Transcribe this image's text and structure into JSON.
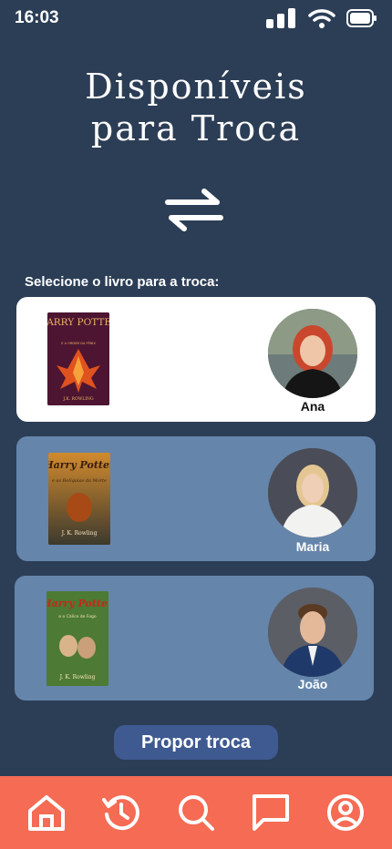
{
  "status": {
    "time": "16:03",
    "icons": [
      "signal-icon",
      "wifi-icon",
      "battery-icon"
    ]
  },
  "header": {
    "title_line1": "Disponíveis",
    "title_line2": "para Troca",
    "icon": "swap-arrows-icon"
  },
  "subtitle": "Selecione o livro para a troca:",
  "cards": [
    {
      "owner": "Ana",
      "book": {
        "title": "HARRY POTTER",
        "subtitle": "E A ORDEM DA FÊNIX",
        "author": "J.K. ROWLING"
      },
      "selected": true
    },
    {
      "owner": "Maria",
      "book": {
        "title": "Harry Potter",
        "subtitle": "e as Relíquias da Morte",
        "author": "J. K. Rowling"
      },
      "selected": false
    },
    {
      "owner": "João",
      "book": {
        "title": "Harry Potter",
        "subtitle": "e o Cálice de Fogo",
        "author": "J. K. Rowling"
      },
      "selected": false
    }
  ],
  "actions": {
    "propose_label": "Propor troca"
  },
  "nav": {
    "items": [
      "home-icon",
      "history-icon",
      "search-icon",
      "chat-icon",
      "profile-icon"
    ]
  },
  "colors": {
    "background": "#2c3e56",
    "card_selected": "#ffffff",
    "card_unselected": "#6585ab",
    "nav": "#f56b54",
    "button": "#3f5a91"
  }
}
